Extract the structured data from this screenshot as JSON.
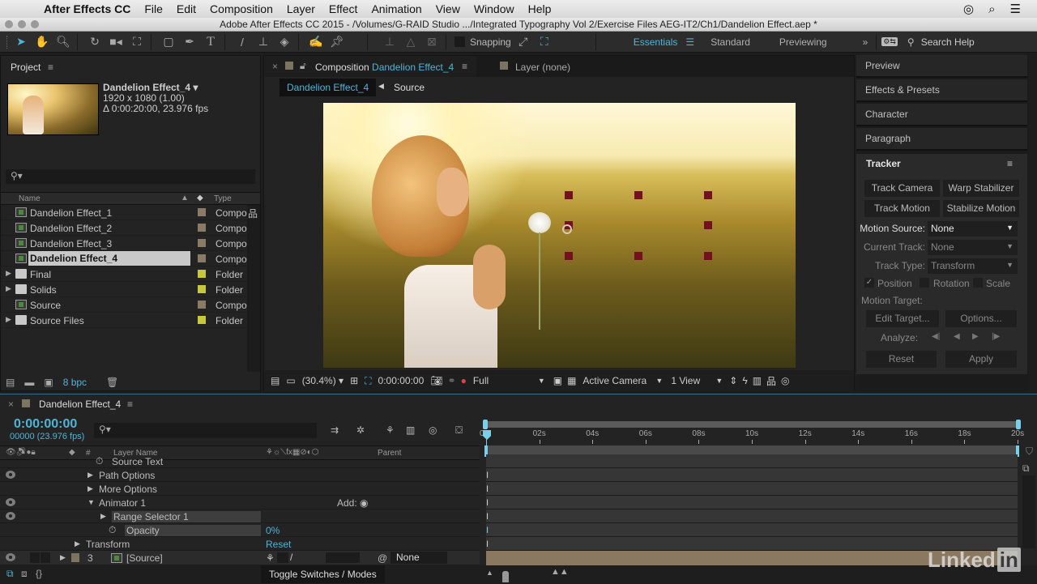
{
  "menubar": {
    "app_name": "After Effects CC",
    "items": [
      "File",
      "Edit",
      "Composition",
      "Layer",
      "Effect",
      "Animation",
      "View",
      "Window",
      "Help"
    ]
  },
  "window": {
    "title": "Adobe After Effects CC 2015 - /Volumes/G-RAID Studio .../Integrated Typography Vol 2/Exercise Files AEG-IT2/Ch1/Dandelion Effect.aep *"
  },
  "toolbar": {
    "snapping_label": "Snapping",
    "workspaces": [
      {
        "label": "Essentials",
        "active": true
      },
      {
        "label": "Standard",
        "active": false
      },
      {
        "label": "Previewing",
        "active": false
      }
    ],
    "search_placeholder": "Search Help"
  },
  "project": {
    "panel_title": "Project",
    "selected": {
      "name": "Dandelion Effect_4",
      "dimensions": "1920 x 1080 (1.00)",
      "duration": "Δ 0:00:20:00, 23.976 fps"
    },
    "columns": {
      "name": "Name",
      "type": "Type"
    },
    "items": [
      {
        "name": "Dandelion Effect_1",
        "kind": "comp",
        "label_color": "#8a7b66",
        "type": "Compo",
        "selected": false
      },
      {
        "name": "Dandelion Effect_2",
        "kind": "comp",
        "label_color": "#8a7b66",
        "type": "Compo",
        "selected": false
      },
      {
        "name": "Dandelion Effect_3",
        "kind": "comp",
        "label_color": "#8a7b66",
        "type": "Compo",
        "selected": false
      },
      {
        "name": "Dandelion Effect_4",
        "kind": "comp",
        "label_color": "#8a7b66",
        "type": "Compo",
        "selected": true
      },
      {
        "name": "Final",
        "kind": "folder",
        "label_color": "#c6c73a",
        "type": "Folder",
        "selected": false
      },
      {
        "name": "Solids",
        "kind": "folder",
        "label_color": "#c6c73a",
        "type": "Folder",
        "selected": false
      },
      {
        "name": "Source",
        "kind": "comp",
        "label_color": "#8a7b66",
        "type": "Compo",
        "selected": false
      },
      {
        "name": "Source Files",
        "kind": "folder",
        "label_color": "#c6c73a",
        "type": "Folder",
        "selected": false
      }
    ],
    "bit_depth": "8 bpc"
  },
  "composition": {
    "tab_prefix": "Composition",
    "tab_name": "Dandelion Effect_4",
    "layer_tab": "Layer (none)",
    "breadcrumb": [
      "Dandelion Effect_4",
      "Source"
    ],
    "footer": {
      "zoom": "(30.4%)",
      "timecode": "0:00:00:00",
      "resolution": "Full",
      "camera": "Active Camera",
      "views": "1 View"
    }
  },
  "right_panels": [
    "Preview",
    "Effects & Presets",
    "Character",
    "Paragraph"
  ],
  "tracker": {
    "title": "Tracker",
    "buttons": [
      "Track Camera",
      "Warp Stabilizer",
      "Track Motion",
      "Stabilize Motion"
    ],
    "motion_source_label": "Motion Source:",
    "motion_source": "None",
    "current_track_label": "Current Track:",
    "current_track": "None",
    "track_type_label": "Track Type:",
    "track_type": "Transform",
    "checks": [
      {
        "label": "Position",
        "checked": true
      },
      {
        "label": "Rotation",
        "checked": false
      },
      {
        "label": "Scale",
        "checked": false
      }
    ],
    "motion_target_label": "Motion Target:",
    "edit_target": "Edit Target...",
    "options": "Options...",
    "analyze_label": "Analyze:",
    "reset": "Reset",
    "apply": "Apply"
  },
  "timeline": {
    "tab_name": "Dandelion Effect_4",
    "timecode": "0:00:00:00",
    "frame_info": "00000 (23.976 fps)",
    "columns": {
      "num": "#",
      "layer_name": "Layer Name",
      "parent": "Parent"
    },
    "rows": [
      {
        "label": "Source Text",
        "indent": 3,
        "arrow": "",
        "eye": false
      },
      {
        "label": "Path Options",
        "indent": 2,
        "arrow": "▶",
        "eye": true
      },
      {
        "label": "More Options",
        "indent": 2,
        "arrow": "▶",
        "eye": false
      },
      {
        "label": "Animator 1",
        "indent": 2,
        "arrow": "▼",
        "eye": true,
        "extra": "Add:"
      },
      {
        "label": "Range Selector 1",
        "indent": 3,
        "arrow": "▶",
        "eye": true
      },
      {
        "label": "Opacity",
        "indent": 4,
        "arrow": "",
        "eye": false,
        "value": "0%"
      },
      {
        "label": "Transform",
        "indent": 1,
        "arrow": "▶",
        "eye": false,
        "value": "Reset"
      }
    ],
    "layer": {
      "number": "3",
      "name": "[Source]",
      "parent": "None"
    },
    "ruler": [
      "0s",
      "02s",
      "04s",
      "06s",
      "08s",
      "10s",
      "12s",
      "14s",
      "16s",
      "18s",
      "20s"
    ],
    "toggle_label": "Toggle Switches / Modes"
  },
  "watermark": {
    "linkedin": "Linked",
    "in": "in"
  }
}
